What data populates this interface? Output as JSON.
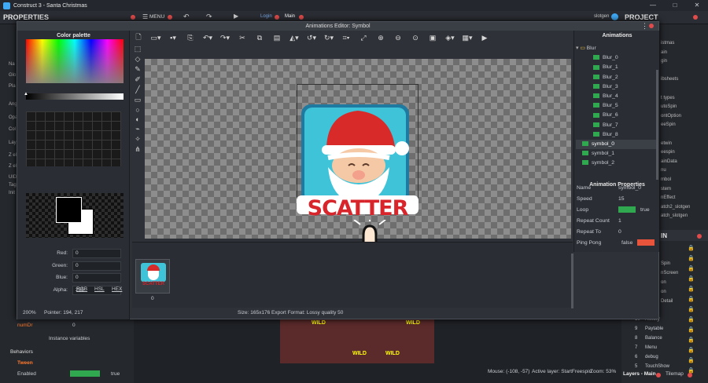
{
  "app": {
    "title": "Construct 3 - Santa Christmas",
    "menu_label": "MENU",
    "user": "slotgen"
  },
  "tabs": [
    {
      "label": "Login"
    },
    {
      "label": "Main"
    }
  ],
  "panels": {
    "properties": "PROPERTIES",
    "project": "PROJECT"
  },
  "left_panel": {
    "instance_var_label": "numDr",
    "instance_var_value": "0",
    "instance_variables": "Instance variables",
    "behaviors": "Behaviors",
    "tween": "Tween",
    "enabled_label": "Enabled",
    "enabled_value": "true"
  },
  "left_stub_labels": [
    "Na",
    "Glo",
    "Pla",
    "Ang",
    "Opa",
    "Col",
    "Lay",
    "Z el",
    "Z el",
    "UID",
    "Tag",
    "Init"
  ],
  "right_stub_labels": [
    "istmas",
    "ain",
    "gin",
    "",
    "ibsheets",
    "",
    "t types",
    "utoSpin",
    "ontOption",
    "eeSpin",
    "",
    "etwin",
    "eespin",
    "ainData",
    "nu",
    "mbol",
    "stem",
    "nEffect",
    "atch2_slotgen",
    "atch_slotgen"
  ],
  "layers_panel": {
    "title": "Layers - Main",
    "items": [
      {
        "n": "10",
        "name": "History"
      },
      {
        "n": "9",
        "name": "Paytable"
      },
      {
        "n": "8",
        "name": "Balance"
      },
      {
        "n": "7",
        "name": "Menu"
      },
      {
        "n": "6",
        "name": "debug"
      },
      {
        "n": "5",
        "name": "TouchShow"
      }
    ],
    "partial": [
      "Spin",
      "nScreen",
      "on",
      "on",
      "Detail"
    ]
  },
  "tilemap_label": "Tilemap",
  "status_bar": {
    "mouse": "Mouse: (-108, -57)",
    "active_layer": "Active layer: StartFreespin",
    "zoom": "Zoom: 53%"
  },
  "dialog": {
    "title": "Animations Editor: Symbol",
    "palette_title": "Color palette",
    "fields": [
      {
        "label": "Red:",
        "value": "0"
      },
      {
        "label": "Green:",
        "value": "0"
      },
      {
        "label": "Blue:",
        "value": "0"
      },
      {
        "label": "Alpha:",
        "value": "255"
      }
    ],
    "color_modes": [
      "RGB",
      "HSL",
      "HEX"
    ],
    "animations_title": "Animations",
    "folder": "Blur",
    "animations": [
      "Blur_0",
      "Blur_1",
      "Blur_2",
      "Blur_3",
      "Blur_4",
      "Blur_5",
      "Blur_6",
      "Blur_7",
      "Blur_8"
    ],
    "symbols": [
      "symbol_0",
      "symbol_1",
      "symbol_2"
    ],
    "props_title": "Animation Properties",
    "props": [
      {
        "k": "Name",
        "v": "symbol_0"
      },
      {
        "k": "Speed",
        "v": "15"
      },
      {
        "k": "Loop",
        "v": "true"
      },
      {
        "k": "Repeat Count",
        "v": "1"
      },
      {
        "k": "Repeat To",
        "v": "0"
      },
      {
        "k": "Ping Pong",
        "v": "false"
      }
    ],
    "sprite_text": "SCATTER",
    "frame_index": "0",
    "zoom": "200%",
    "pointer": "Pointer: 194, 217",
    "size": "Size: 165x176",
    "export": "Export Format: Lossy quality 50"
  },
  "slot_words": [
    "WILD",
    "WILD",
    "WILD",
    "WILD"
  ],
  "colors": {
    "accent": "#3fa9f5",
    "green": "#2fa84f",
    "red": "#e24b4b",
    "orange": "#ff7a2e"
  }
}
